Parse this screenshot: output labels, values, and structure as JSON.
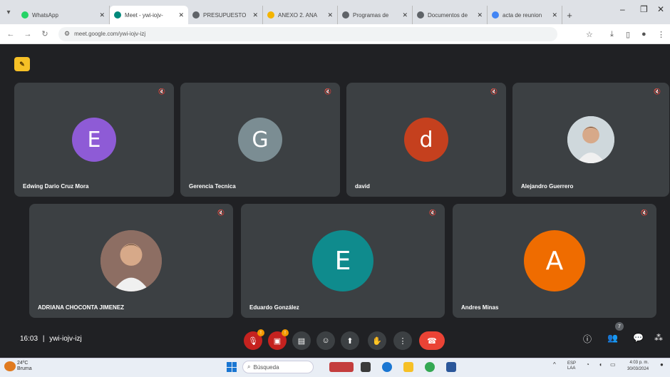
{
  "browser": {
    "tabs": [
      {
        "label": "WhatsApp",
        "color": "#25d366",
        "active": false
      },
      {
        "label": "Meet - ywi-iojv-",
        "color": "#00897b",
        "active": true
      },
      {
        "label": "PRESUPUESTO",
        "color": "#5f6368",
        "active": false
      },
      {
        "label": "ANEXO 2. ANA",
        "color": "#f4b400",
        "active": false
      },
      {
        "label": "Programas de",
        "color": "#5f6368",
        "active": false
      },
      {
        "label": "Documentos de",
        "color": "#5f6368",
        "active": false
      },
      {
        "label": "acta de reunion",
        "color": "#4285f4",
        "active": false
      }
    ],
    "new_tab": "+",
    "url": "meet.google.com/ywi-iojv-izj"
  },
  "meet": {
    "participants": [
      {
        "name": "Edwing Dario Cruz Mora",
        "initial": "E",
        "color": "#8e5bd6",
        "photo": false
      },
      {
        "name": "Gerencia Tecnica",
        "initial": "G",
        "color": "#7b8d93",
        "photo": false
      },
      {
        "name": "david",
        "initial": "d",
        "color": "#c5401e",
        "photo": false
      },
      {
        "name": "Alejandro Guerrero",
        "initial": "",
        "color": "#cfd8dc",
        "photo": true
      },
      {
        "name": "ADRIANA CHOCONTA JIMENEZ",
        "initial": "",
        "color": "#8d6e63",
        "photo": true
      },
      {
        "name": "Eduardo González",
        "initial": "E",
        "color": "#0f8b8d",
        "photo": false
      },
      {
        "name": "Andres Minas",
        "initial": "A",
        "color": "#ef6c00",
        "photo": false
      }
    ],
    "time": "16:03",
    "separator": "|",
    "meeting_code": "ywi-iojv-izj",
    "people_count": "7",
    "colors": {
      "bg": "#202124",
      "tile": "#3c4043",
      "hangup": "#ea4335",
      "warn": "#f29900"
    }
  },
  "taskbar": {
    "weather_temp": "24ºC",
    "weather_desc": "Bruma",
    "search_placeholder": "Búsqueda",
    "tray_lang": "ESP",
    "tray_lang2": "LAA",
    "time": "4:03 p. m.",
    "date": "30/03/2024"
  }
}
